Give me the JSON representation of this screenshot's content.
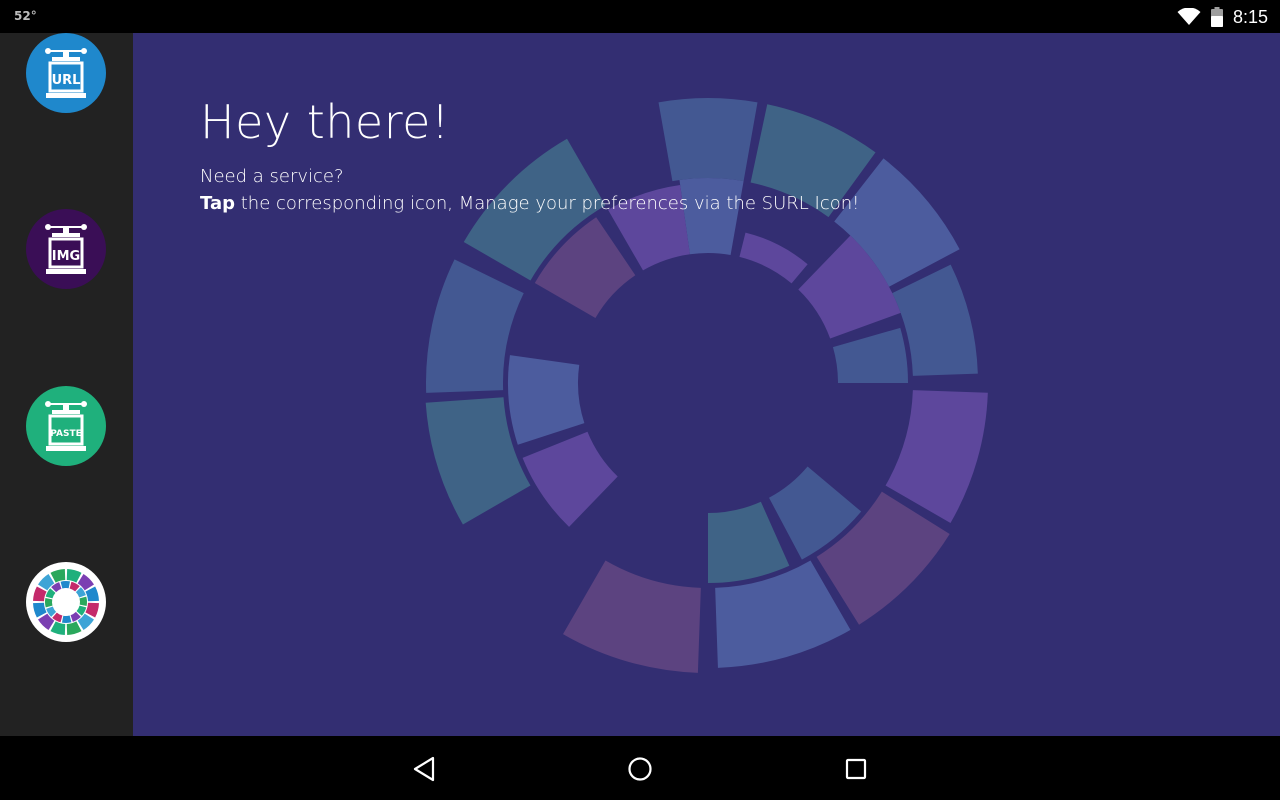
{
  "status": {
    "temperature": "52°",
    "time": "8:15"
  },
  "sidebar": {
    "items": [
      {
        "label": "URL",
        "color": "#1f88cc"
      },
      {
        "label": "IMG",
        "color": "#3a0e56"
      },
      {
        "label": "PASTE",
        "color": "#1fb07c"
      },
      {
        "label": "",
        "color": "#ffffff"
      }
    ]
  },
  "main": {
    "heading": "Hey there!",
    "line1": "Need a service?",
    "line2_bold": "Tap",
    "line2_rest": " the corresponding icon, Manage your preferences via the SURL Icon!",
    "background": "#332e72"
  },
  "navbar": {
    "icons": [
      "back-icon",
      "home-icon",
      "recents-icon"
    ]
  }
}
